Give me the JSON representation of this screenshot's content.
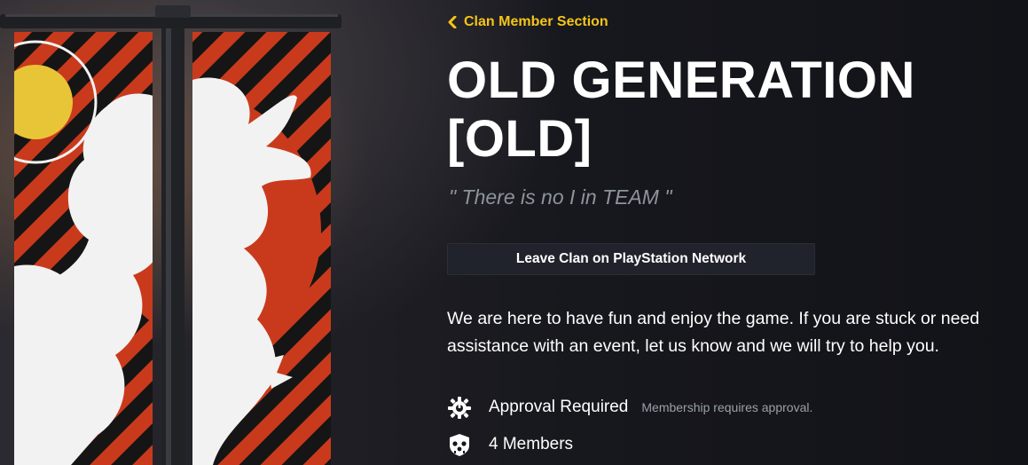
{
  "nav": {
    "back_label": "Clan Member Section"
  },
  "clan": {
    "name": "OLD GENERATION [OLD]",
    "motto": "\" There is no I in TEAM \"",
    "description": "We are here to have fun and enjoy the game. If you are stuck or need assistance with an event, let us know and we will try to help you."
  },
  "actions": {
    "leave_label": "Leave Clan on PlayStation Network"
  },
  "info": {
    "approval_label": "Approval Required",
    "approval_note": "Membership requires approval.",
    "members_label": "4 Members"
  },
  "icons": {
    "back": "chevron-left-icon",
    "approval": "approval-gear-icon",
    "members": "members-skull-icon"
  },
  "colors": {
    "accent": "#f5c518",
    "banner_red": "#c93a1c",
    "banner_yellow": "#e8c537",
    "banner_black": "#151515",
    "button_bg": "#20232b",
    "muted_text": "#8e949c"
  }
}
